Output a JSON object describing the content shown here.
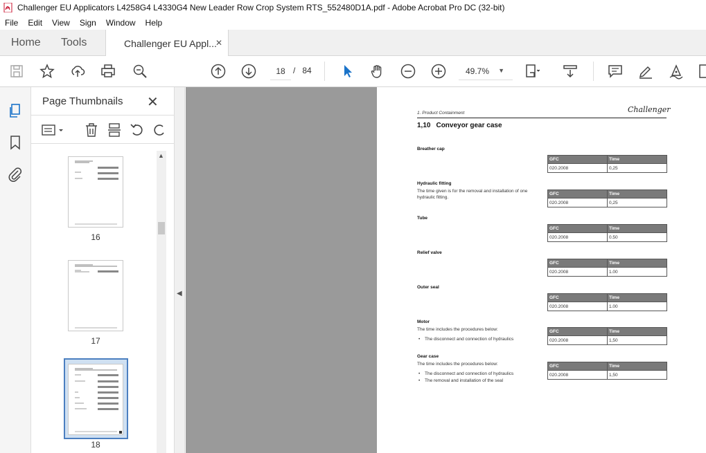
{
  "window": {
    "title": "Challenger EU Applicators L4258G4 L4330G4 New Leader Row Crop System RTS_552480D1A.pdf - Adobe Acrobat Pro DC (32-bit)"
  },
  "menu": [
    "File",
    "Edit",
    "View",
    "Sign",
    "Window",
    "Help"
  ],
  "tabs": {
    "home": "Home",
    "tools": "Tools",
    "document": "Challenger EU Appl...",
    "close": "✕"
  },
  "toolbar": {
    "current_page": "18",
    "page_separator": "/",
    "total_pages": "84",
    "zoom": "49.7%"
  },
  "thumbnails_panel": {
    "title": "Page Thumbnails",
    "close": "✕",
    "pages": [
      "16",
      "17",
      "18"
    ]
  },
  "document": {
    "header": "1. Product Containment",
    "logo": "Challenger",
    "section_number": "1,10",
    "section_title": "Conveyor gear case",
    "table_headers": [
      "GFC",
      "Time"
    ],
    "items": [
      {
        "title": "Breather cap",
        "desc": "",
        "bullets": [],
        "gfc": "020.2008",
        "time": "0,25"
      },
      {
        "title": "Hydraulic fitting",
        "desc": "The time given is for the removal and installation of one hydraulic fitting.",
        "bullets": [],
        "gfc": "020.2008",
        "time": "0,25"
      },
      {
        "title": "Tube",
        "desc": "",
        "bullets": [],
        "gfc": "020.2008",
        "time": "0.50"
      },
      {
        "title": "Relief valve",
        "desc": "",
        "bullets": [],
        "gfc": "020.2008",
        "time": "1.00"
      },
      {
        "title": "Outer seal",
        "desc": "",
        "bullets": [],
        "gfc": "020.2008",
        "time": "1.00"
      },
      {
        "title": "Motor",
        "desc": "The time includes the procedures below:",
        "bullets": [
          "The disconnect and connection of hydraulics"
        ],
        "gfc": "020.2008",
        "time": "1,50"
      },
      {
        "title": "Gear case",
        "desc": "The time includes the procedures below:",
        "bullets": [
          "The disconnect and connection of hydraulics",
          "The removal and installation of the seal"
        ],
        "gfc": "020.2008",
        "time": "1,50"
      }
    ]
  },
  "colors": {
    "canvas": "#9a9a9a",
    "accent_blue": "#1a73c9",
    "table_header": "#7a7a7a"
  }
}
